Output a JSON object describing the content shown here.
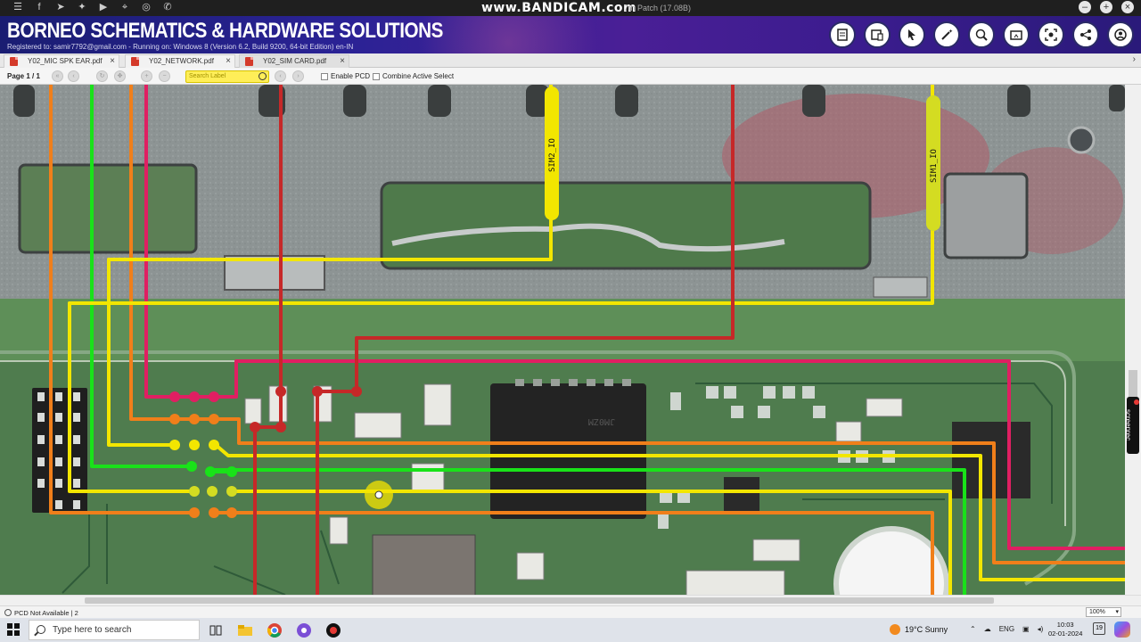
{
  "titlebar": {
    "watermark": "www.BANDICAM.com",
    "patch_text": "7th Patch (17.08B)",
    "icons": [
      "menu-icon",
      "facebook-icon",
      "telegram-icon",
      "twitter-icon",
      "youtube-icon",
      "map-icon",
      "web-icon",
      "whatsapp-icon"
    ]
  },
  "banner": {
    "app_title": "BORNEO SCHEMATICS & HARDWARE SOLUTIONS",
    "registration": "Registered to: samir7792@gmail.com - Running on: Windows 8 (Version 6.2, Build 9200, 64-bit Edition) en-IN",
    "tools": [
      "document-icon",
      "tablet-icon",
      "pointer-icon",
      "magic-wand-icon",
      "zoom-icon",
      "folder-icon",
      "capture-icon",
      "share-icon",
      "account-icon"
    ]
  },
  "tabs": [
    {
      "label": "Y02_MIC SPK EAR.pdf",
      "active": false
    },
    {
      "label": "Y02_NETWORK.pdf",
      "active": false
    },
    {
      "label": "Y02_SIM CARD.pdf",
      "active": true
    }
  ],
  "toolbar": {
    "page_label": "Page 1 / 1",
    "search_placeholder": "Search Label",
    "enable_pcd": "Enable PCD",
    "combine_active": "Combine Active Select"
  },
  "board": {
    "labels": [
      "SIM2_IO",
      "SIM1_IO"
    ],
    "chip_marking": "JM0ZM",
    "colors": {
      "board": "#4d7a4d",
      "shield": "#8e9595",
      "yellow": "#f2e600",
      "red": "#c62828",
      "pink": "#e01f62",
      "orange": "#f07f1a",
      "green": "#19e219"
    }
  },
  "side_recorder": "screenrec",
  "status": {
    "text": "PCD Not Available | 2",
    "zoom": "100%"
  },
  "taskbar": {
    "search_placeholder": "Type here to search",
    "weather": "19°C  Sunny",
    "language": "ENG",
    "time": "10:03",
    "date": "02-01-2024",
    "notifications": "19",
    "pinned": [
      "task-view-icon",
      "file-explorer-icon",
      "chrome-icon",
      "app-icon",
      "record-icon"
    ]
  }
}
